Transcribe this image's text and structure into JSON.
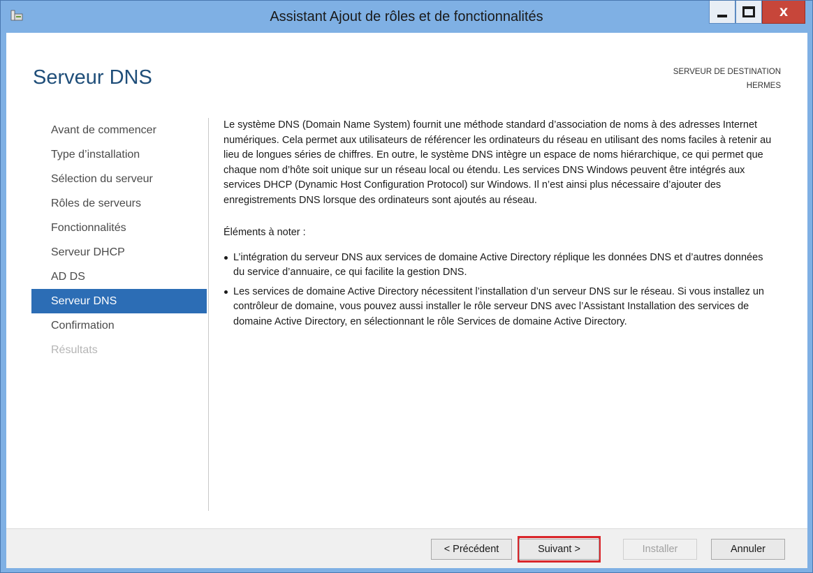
{
  "window": {
    "title": "Assistant Ajout de rôles et de fonctionnalités",
    "min_glyph": "_",
    "max_glyph": "□",
    "close_glyph": "X"
  },
  "page": {
    "title": "Serveur DNS",
    "destination_label": "SERVEUR DE DESTINATION",
    "destination_server": "HERMES"
  },
  "nav": {
    "items": [
      {
        "label": "Avant de commencer",
        "state": "normal"
      },
      {
        "label": "Type d’installation",
        "state": "normal"
      },
      {
        "label": "Sélection du serveur",
        "state": "normal"
      },
      {
        "label": "Rôles de serveurs",
        "state": "normal"
      },
      {
        "label": "Fonctionnalités",
        "state": "normal"
      },
      {
        "label": "Serveur DHCP",
        "state": "normal"
      },
      {
        "label": "AD DS",
        "state": "normal"
      },
      {
        "label": "Serveur DNS",
        "state": "active"
      },
      {
        "label": "Confirmation",
        "state": "normal"
      },
      {
        "label": "Résultats",
        "state": "disabled"
      }
    ]
  },
  "content": {
    "intro": "Le système DNS (Domain Name System) fournit une méthode standard d’association de noms à des adresses Internet numériques. Cela permet aux utilisateurs de référencer les ordinateurs du réseau en utilisant des noms faciles à retenir au lieu de longues séries de chiffres. En outre, le système DNS intègre un espace de noms hiérarchique, ce qui permet que chaque nom d’hôte soit unique sur un réseau local ou étendu. Les services DNS Windows peuvent être intégrés aux services DHCP (Dynamic Host Configuration Protocol) sur Windows. Il n’est ainsi plus nécessaire d’ajouter des enregistrements DNS lorsque des ordinateurs sont ajoutés au réseau.",
    "notes_heading": "Éléments à noter :",
    "notes": [
      "L’intégration du serveur DNS aux services de domaine Active Directory réplique les données DNS et d’autres données du service d’annuaire, ce qui facilite la gestion DNS.",
      "Les services de domaine Active Directory nécessitent l’installation d’un serveur DNS sur le réseau. Si vous installez un contrôleur de domaine, vous pouvez aussi installer le rôle serveur DNS avec l’Assistant Installation des services de domaine Active Directory, en sélectionnant le rôle Services de domaine Active Directory."
    ]
  },
  "footer": {
    "prev_label": "< Précédent",
    "next_label": "Suivant >",
    "install_label": "Installer",
    "cancel_label": "Annuler"
  },
  "colors": {
    "accent": "#2c6db5",
    "title_bar": "#7fb0e4",
    "highlight": "#d9262b"
  }
}
